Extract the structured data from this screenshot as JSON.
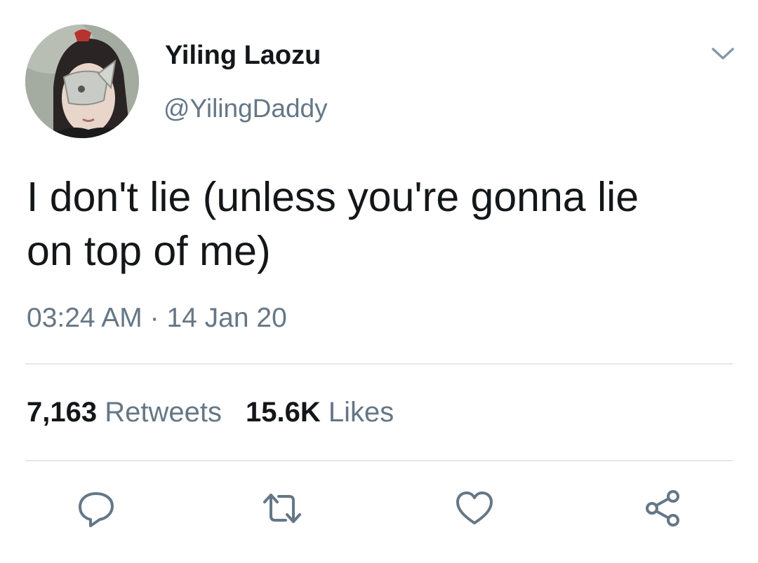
{
  "tweet": {
    "author": {
      "display_name": "Yiling Laozu",
      "handle": "@YilingDaddy",
      "avatar_icon": "avatar"
    },
    "text_line1": "I don't lie (unless you're gonna lie",
    "text_line2": "on top of me)",
    "time": "03:24 AM",
    "separator": "·",
    "date": "14 Jan 20"
  },
  "stats": {
    "retweets_count": "7,163",
    "retweets_label": "Retweets",
    "likes_count": "15.6K",
    "likes_label": "Likes"
  },
  "actions": [
    {
      "name": "reply",
      "icon": "reply-icon"
    },
    {
      "name": "retweet",
      "icon": "retweet-icon"
    },
    {
      "name": "like",
      "icon": "heart-icon"
    },
    {
      "name": "share",
      "icon": "share-icon"
    }
  ],
  "colors": {
    "primary_text": "#14171a",
    "secondary_text": "#657786",
    "divider": "#e1e8ed",
    "icon_gray": "#657786"
  }
}
